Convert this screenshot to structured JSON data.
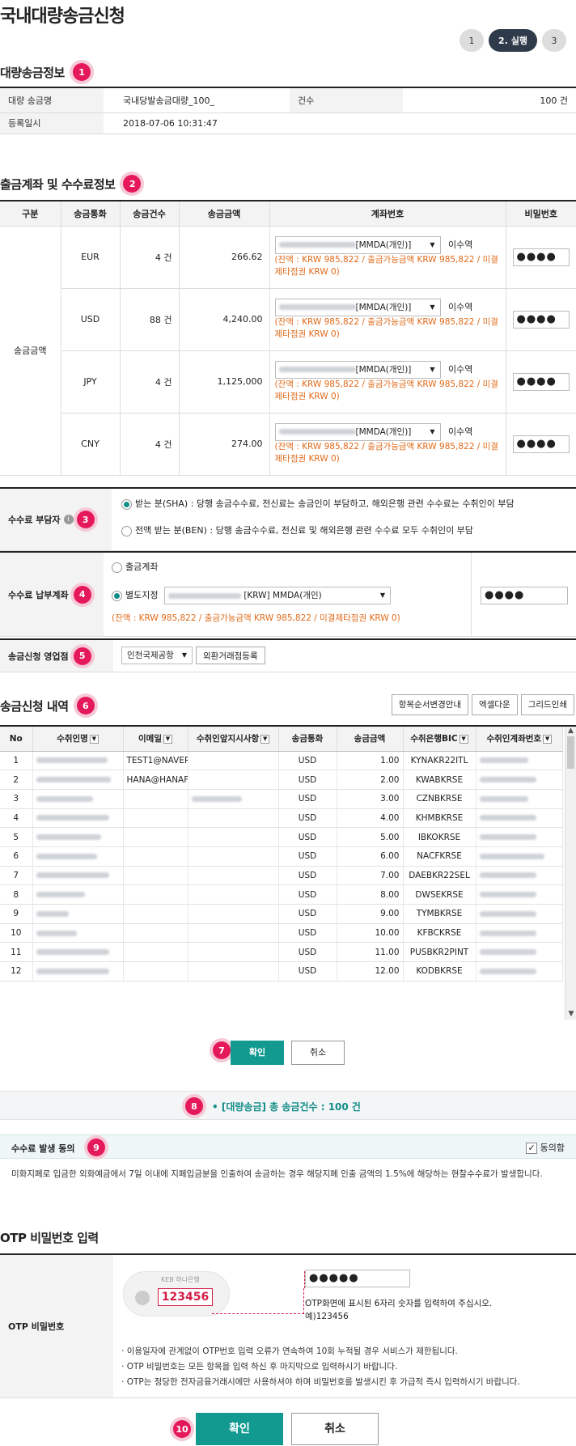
{
  "page_title": "국내대량송금신청",
  "steps": [
    "1",
    "2. 실행",
    "3"
  ],
  "badges": [
    "1",
    "2",
    "3",
    "4",
    "5",
    "6",
    "7",
    "8",
    "9",
    "10"
  ],
  "bulk_info": {
    "section_title": "대량송금정보",
    "name_label": "대량 송금명",
    "name_value": "국내당발송금대량_100_",
    "count_label": "건수",
    "count_value": "100 건",
    "date_label": "등록일시",
    "date_value": "2018-07-06 10:31:47"
  },
  "account_info": {
    "section_title": "출금계좌 및 수수료정보",
    "headers": [
      "구분",
      "송금통화",
      "송금건수",
      "송금금액",
      "계좌번호",
      "비밀번호"
    ],
    "row_group_label": "송금금액",
    "account_select": "[MMDA(개인)]",
    "owner": "이수역",
    "balance_line1": "(잔액 : KRW 985,822 / 출금가능금액 KRW 985,822 / 미결",
    "balance_line2": "제타점권 KRW 0)",
    "pw_mask": "●●●●",
    "rows": [
      {
        "currency": "EUR",
        "count": "4 건",
        "amount": "266.62"
      },
      {
        "currency": "USD",
        "count": "88 건",
        "amount": "4,240.00"
      },
      {
        "currency": "JPY",
        "count": "4 건",
        "amount": "1,125,000"
      },
      {
        "currency": "CNY",
        "count": "4 건",
        "amount": "274.00"
      }
    ]
  },
  "fee_payer": {
    "label": "수수료 부담자",
    "info_icon": "i",
    "option_sha": "받는 분(SHA) : 당행 송금수수료, 전신료는 송금인이 부담하고, 해외은행 관련 수수료는 수취인이 부담",
    "option_ben": "전액 받는 분(BEN) : 당행 송금수수료, 전신료 및 해외은행 관련 수수료 모두 수취인이 부담"
  },
  "fee_account": {
    "label": "수수료 납부계좌",
    "option_withdraw": "출금계좌",
    "option_separate": "별도지정",
    "select_value": "[KRW] MMDA(개인)",
    "balance": "(잔액 : KRW 985,822 / 출금가능금액 KRW 985,822 / 미결제타점권 KRW 0)",
    "pw_mask": "●●●●"
  },
  "branch": {
    "label": "송금신청 영업점",
    "select_value": "인천국제공항",
    "register_button": "외환거래점등록"
  },
  "details": {
    "section_title": "송금신청 내역",
    "buttons": [
      "항목순서변경안내",
      "엑셀다운",
      "그리드인쇄"
    ],
    "headers": [
      "No",
      "수취인명",
      "이메일",
      "수취인앞지시사항",
      "송금통화",
      "송금금액",
      "수취은행BIC",
      "수취인계좌번호"
    ],
    "rows": [
      {
        "no": "1",
        "email": "TEST1@NAVER",
        "note": "",
        "cur": "USD",
        "amt": "1.00",
        "bic": "KYNAKR22ITL"
      },
      {
        "no": "2",
        "email": "HANA@HANAF",
        "note": "",
        "cur": "USD",
        "amt": "2.00",
        "bic": "KWABKRSE"
      },
      {
        "no": "3",
        "email": "",
        "note": "blur",
        "cur": "USD",
        "amt": "3.00",
        "bic": "CZNBKRSE"
      },
      {
        "no": "4",
        "email": "",
        "note": "",
        "cur": "USD",
        "amt": "4.00",
        "bic": "KHMBKRSE"
      },
      {
        "no": "5",
        "email": "",
        "note": "",
        "cur": "USD",
        "amt": "5.00",
        "bic": "IBKOKRSE"
      },
      {
        "no": "6",
        "email": "",
        "note": "",
        "cur": "USD",
        "amt": "6.00",
        "bic": "NACFKRSE"
      },
      {
        "no": "7",
        "email": "",
        "note": "",
        "cur": "USD",
        "amt": "7.00",
        "bic": "DAEBKR22SEL"
      },
      {
        "no": "8",
        "email": "",
        "note": "",
        "cur": "USD",
        "amt": "8.00",
        "bic": "DWSEKRSE"
      },
      {
        "no": "9",
        "email": "",
        "note": "",
        "cur": "USD",
        "amt": "9.00",
        "bic": "TYMBKRSE"
      },
      {
        "no": "10",
        "email": "",
        "note": "",
        "cur": "USD",
        "amt": "10.00",
        "bic": "KFBCKRSE"
      },
      {
        "no": "11",
        "email": "",
        "note": "",
        "cur": "USD",
        "amt": "11.00",
        "bic": "PUSBKR2PINT"
      },
      {
        "no": "12",
        "email": "",
        "note": "",
        "cur": "USD",
        "amt": "12.00",
        "bic": "KODBKRSE"
      }
    ]
  },
  "confirm_small": "확인",
  "cancel_small": "취소",
  "summary": "[대량송금] 총 송금건수 : 100 건",
  "fee_consent": {
    "title": "수수료 발생 동의",
    "agree_label": "동의함",
    "text": "미화지폐로 입금한 외화예금에서 7일 이내에 지폐입금분을 인출하여 송금하는 경우 해당지폐 인출 금액의 1.5%에 해당하는 현찰수수료가 발생합니다."
  },
  "otp": {
    "section_title": "OTP 비밀번호 입력",
    "label": "OTP 비밀번호",
    "bank_name": "KEB 하나은행",
    "sample_number": "123456",
    "input_mask": "●●●●●",
    "hint1": "OTP화면에 표시된 6자리 숫자를 입력하여 주십시오.",
    "hint2": "예)123456",
    "notes": [
      "이용일자에 관계없이 OTP번호 입력 오류가 연속하여 10회 누적될 경우 서비스가 제한됩니다.",
      "OTP 비밀번호는 모든 항목을 입력 하신 후 마지막으로 입력하시기 바랍니다.",
      "OTP는 정당한 전자금융거래시에만 사용하셔야 하며 비밀번호를 발생시킨 후 가급적 즉시 입력하시기 바랍니다."
    ]
  },
  "confirm_big": "확인",
  "cancel_big": "취소"
}
